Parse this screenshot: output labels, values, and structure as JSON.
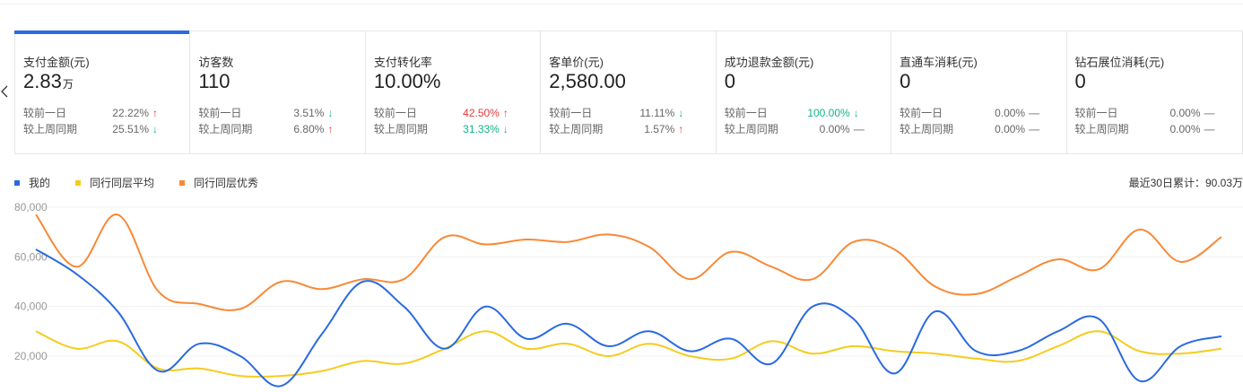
{
  "cards": [
    {
      "title": "支付金额(元)",
      "value": "2.83",
      "unit": "万",
      "cmp": [
        {
          "label": "较前一日",
          "pct": "22.22%",
          "dir": "up"
        },
        {
          "label": "较上周同期",
          "pct": "25.51%",
          "dir": "down"
        }
      ]
    },
    {
      "title": "访客数",
      "value": "110",
      "unit": "",
      "cmp": [
        {
          "label": "较前一日",
          "pct": "3.51%",
          "dir": "down"
        },
        {
          "label": "较上周同期",
          "pct": "6.80%",
          "dir": "up"
        }
      ]
    },
    {
      "title": "支付转化率",
      "value": "10.00%",
      "unit": "",
      "cmp": [
        {
          "label": "较前一日",
          "pct": "42.50%",
          "dir": "up",
          "color": "red"
        },
        {
          "label": "较上周同期",
          "pct": "31.33%",
          "dir": "down",
          "color": "green"
        }
      ]
    },
    {
      "title": "客单价(元)",
      "value": "2,580.00",
      "unit": "",
      "cmp": [
        {
          "label": "较前一日",
          "pct": "11.11%",
          "dir": "down"
        },
        {
          "label": "较上周同期",
          "pct": "1.57%",
          "dir": "up"
        }
      ]
    },
    {
      "title": "成功退款金额(元)",
      "value": "0",
      "unit": "",
      "cmp": [
        {
          "label": "较前一日",
          "pct": "100.00%",
          "dir": "down",
          "color": "green"
        },
        {
          "label": "较上周同期",
          "pct": "0.00%",
          "dir": "flat"
        }
      ]
    },
    {
      "title": "直通车消耗(元)",
      "value": "0",
      "unit": "",
      "cmp": [
        {
          "label": "较前一日",
          "pct": "0.00%",
          "dir": "flat"
        },
        {
          "label": "较上周同期",
          "pct": "0.00%",
          "dir": "flat"
        }
      ]
    },
    {
      "title": "钻石展位消耗(元)",
      "value": "0",
      "unit": "",
      "cmp": [
        {
          "label": "较前一日",
          "pct": "0.00%",
          "dir": "flat"
        },
        {
          "label": "较上周同期",
          "pct": "0.00%",
          "dir": "flat"
        }
      ]
    }
  ],
  "icons": {
    "up": "↑",
    "down": "↓",
    "flat": "—",
    "back": "chevron-left-icon"
  },
  "colors": {
    "accent": "#2a6ae0",
    "up": "#e4393c",
    "down": "#13b38b"
  },
  "legend": [
    {
      "name": "我的",
      "color": "#2a6ae0"
    },
    {
      "name": "同行同层平均",
      "color": "#f5cc1e"
    },
    {
      "name": "同行同层优秀",
      "color": "#f88936"
    }
  ],
  "summary": "最近30日累计：90.03万",
  "chart_data": {
    "type": "line",
    "yticks": [
      "80,000",
      "60,000",
      "40,000",
      "20,000"
    ],
    "ytick_values": [
      80000,
      60000,
      40000,
      20000
    ],
    "ylim": [
      10000,
      80000
    ],
    "series": [
      {
        "name": "我的",
        "color": "#2a6ae0",
        "values": [
          63000,
          53000,
          38000,
          14000,
          25000,
          20000,
          8000,
          29000,
          50000,
          40000,
          23000,
          40000,
          27000,
          33000,
          24000,
          30000,
          22000,
          27000,
          17000,
          40000,
          35000,
          13000,
          38000,
          22000,
          22000,
          30000,
          35000,
          10000,
          24000,
          28000
        ]
      },
      {
        "name": "同行同层平均",
        "color": "#f5cc1e",
        "values": [
          30000,
          23000,
          26000,
          15000,
          15000,
          12000,
          12000,
          14000,
          18000,
          17000,
          23000,
          30000,
          23000,
          25000,
          20000,
          25000,
          20000,
          19000,
          26000,
          21000,
          24000,
          22000,
          21000,
          19000,
          18000,
          24000,
          30000,
          22000,
          21000,
          23000
        ]
      },
      {
        "name": "同行同层优秀",
        "color": "#f88936",
        "values": [
          77000,
          56000,
          77000,
          46000,
          41000,
          39000,
          50000,
          47000,
          51000,
          51000,
          68000,
          65000,
          67000,
          66000,
          69000,
          64000,
          51000,
          62000,
          56000,
          51000,
          66000,
          63000,
          48000,
          45000,
          52000,
          59000,
          55000,
          71000,
          58000,
          68000
        ]
      }
    ]
  }
}
